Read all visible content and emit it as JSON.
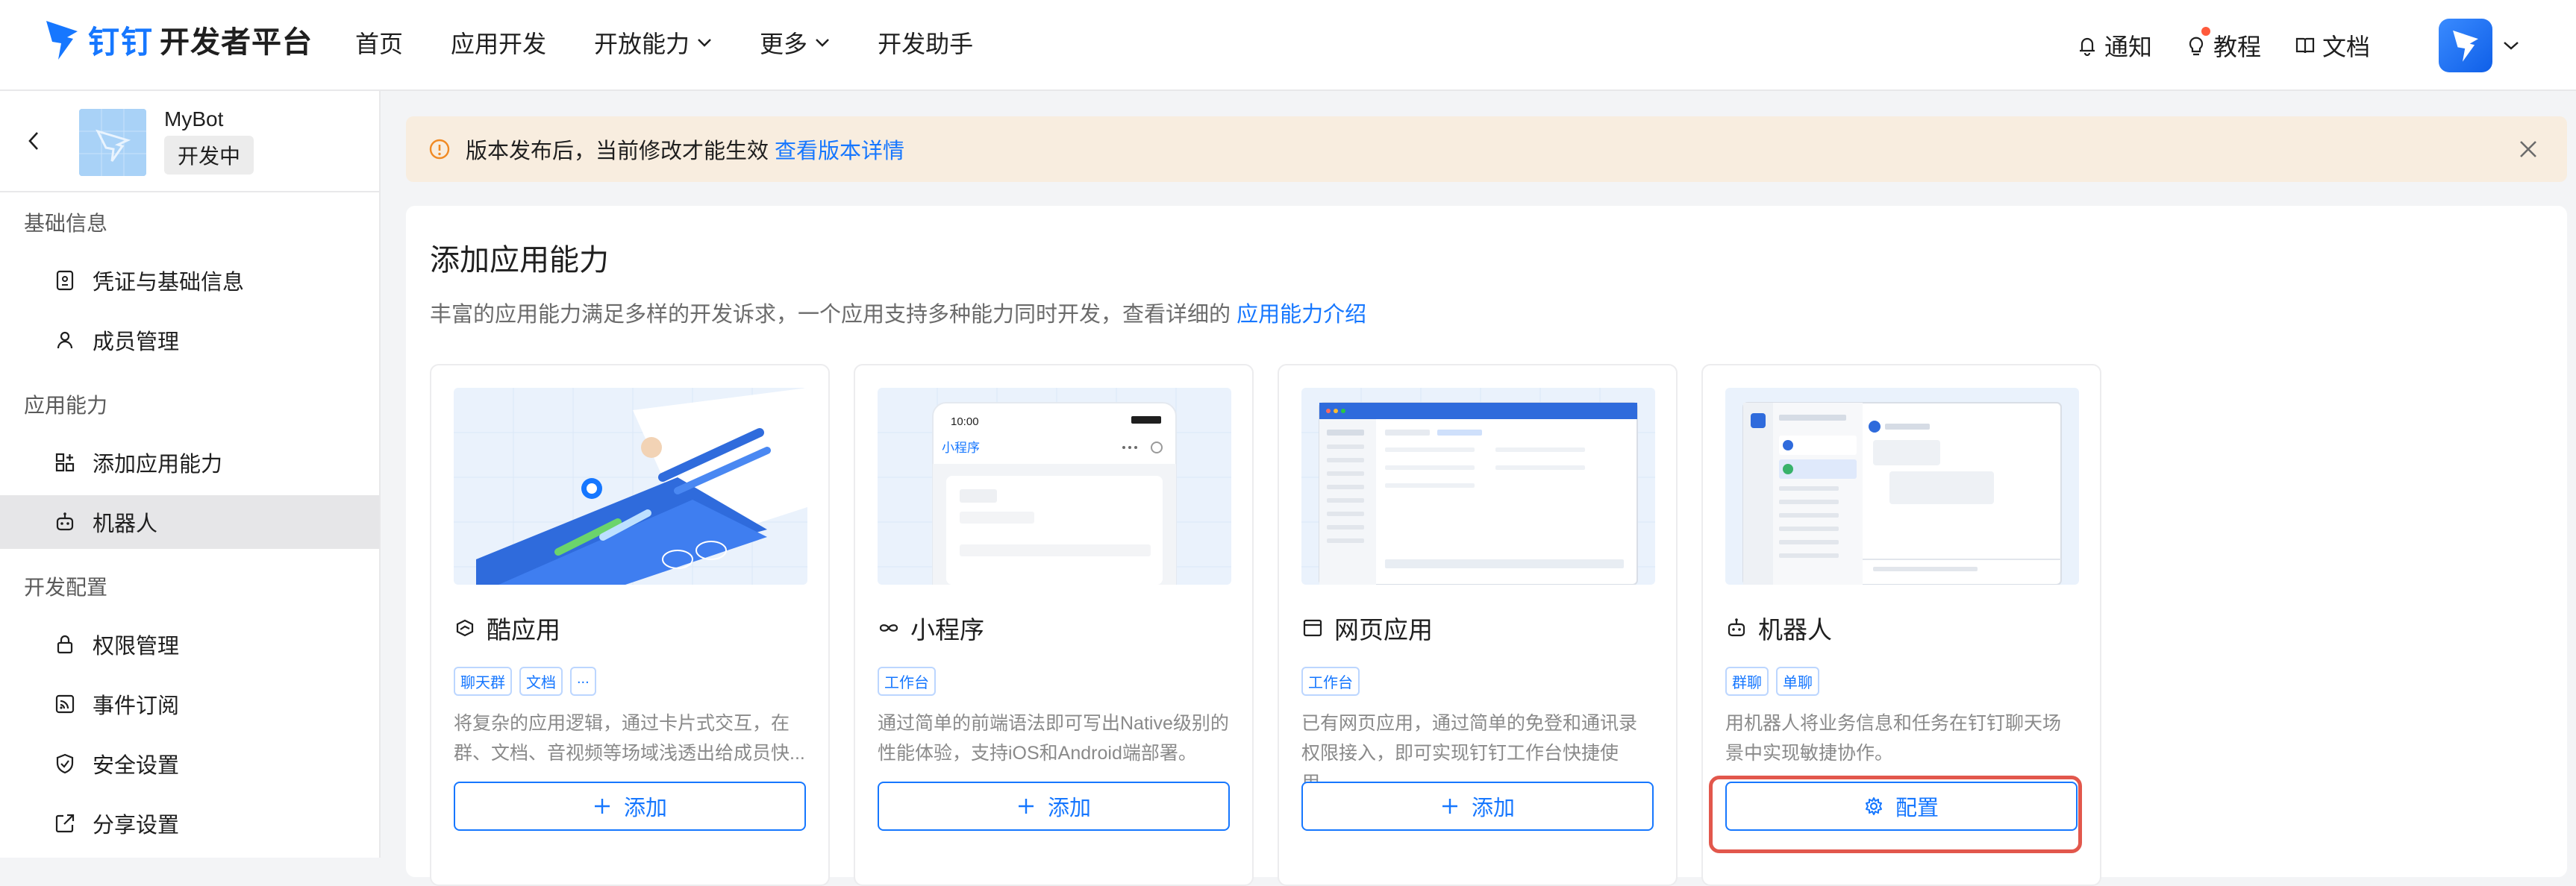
{
  "brand": {
    "logo_dingding": "钉钉",
    "platform": "开发者平台"
  },
  "nav": {
    "items": [
      "首页",
      "应用开发",
      "开放能力",
      "更多",
      "开发助手"
    ]
  },
  "tools": {
    "notify": "通知",
    "tutorial": "教程",
    "docs": "文档"
  },
  "app": {
    "name": "MyBot",
    "status": "开发中"
  },
  "sidebar": {
    "sections": [
      {
        "title": "基础信息",
        "items": [
          "凭证与基础信息",
          "成员管理"
        ]
      },
      {
        "title": "应用能力",
        "items": [
          "添加应用能力",
          "机器人"
        ]
      },
      {
        "title": "开发配置",
        "items": [
          "权限管理",
          "事件订阅",
          "安全设置",
          "分享设置"
        ]
      }
    ],
    "active_item": "机器人"
  },
  "notice": {
    "text": "版本发布后，当前修改才能生效",
    "link": "查看版本详情"
  },
  "panel": {
    "title": "添加应用能力",
    "desc": "丰富的应用能力满足多样的开发诉求，一个应用支持多种能力同时开发，查看详细的",
    "desc_link": "应用能力介绍"
  },
  "cards": [
    {
      "title": "酷应用",
      "tags": [
        "聊天群",
        "文档",
        "..."
      ],
      "desc": "将复杂的应用逻辑，通过卡片式交互，在群、文档、音视频等场域浅透出给成员快...",
      "button": "添加",
      "icon": "cool-app-icon"
    },
    {
      "title": "小程序",
      "tags": [
        "工作台"
      ],
      "desc": "通过简单的前端语法即可写出Native级别的性能体验，支持iOS和Android端部署。",
      "button": "添加",
      "icon": "miniprogram-icon",
      "mock": {
        "time": "10:00",
        "title": "小程序"
      }
    },
    {
      "title": "网页应用",
      "tags": [
        "工作台"
      ],
      "desc": "已有网页应用，通过简单的免登和通讯录权限接入，即可实现钉钉工作台快捷使用。",
      "button": "添加",
      "icon": "web-app-icon"
    },
    {
      "title": "机器人",
      "tags": [
        "群聊",
        "单聊"
      ],
      "desc": "用机器人将业务信息和任务在钉钉聊天场景中实现敏捷协作。",
      "button": "配置",
      "icon": "robot-icon"
    }
  ],
  "colors": {
    "primary": "#1677ff",
    "notice_bg": "#f8eddf",
    "highlight": "#e2574c"
  }
}
